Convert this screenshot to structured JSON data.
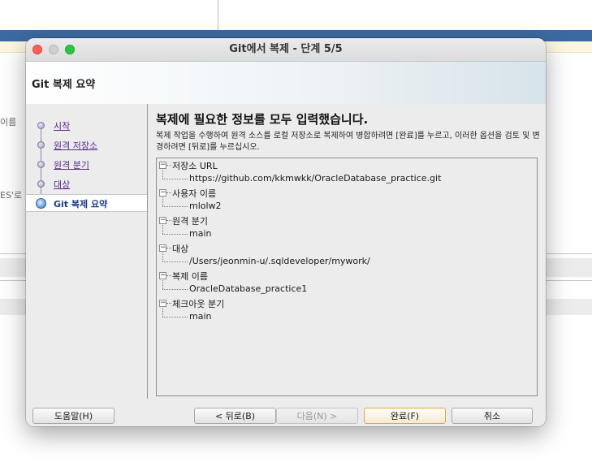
{
  "background": {
    "label_name": "이름",
    "label_es": "ES'로"
  },
  "window": {
    "title": "Git에서 복제 - 단계 5/5"
  },
  "header": {
    "title": "Git 복제 요약"
  },
  "steps": [
    {
      "label": "시작"
    },
    {
      "label": "원격 저장소"
    },
    {
      "label": "원격 분기"
    },
    {
      "label": "대상"
    },
    {
      "label": "Git 복제 요약"
    }
  ],
  "main": {
    "heading": "복제에 필요한 정보를 모두 입력했습니다.",
    "description": "복제 작업을 수행하여 원격 소스를 로컬 저장소로 복제하여 병합하려면 [완료]를 누르고, 이러한 옵션을 검토 및 변경하려면 [뒤로]를 누르십시오."
  },
  "summary": [
    {
      "label": "저장소 URL",
      "value": "https://github.com/kkmwkk/OracleDatabase_practice.git"
    },
    {
      "label": "사용자 이름",
      "value": "mlolw2"
    },
    {
      "label": "원격 분기",
      "value": "main"
    },
    {
      "label": "대상",
      "value": "/Users/jeonmin-u/.sqldeveloper/mywork/"
    },
    {
      "label": "복제 이름",
      "value": "OracleDatabase_practice1"
    },
    {
      "label": "체크아웃 분기",
      "value": "main"
    }
  ],
  "buttons": {
    "help": "도움말(H)",
    "back": "< 뒤로(B)",
    "next": "다음(N) >",
    "finish": "완료(F)",
    "cancel": "취소"
  },
  "colors": {
    "app_bar": "#3c6aa0",
    "visited_link": "#5a2a8a",
    "active_step": "#1a3a8a",
    "primary_button_border": "#e7a33e"
  }
}
